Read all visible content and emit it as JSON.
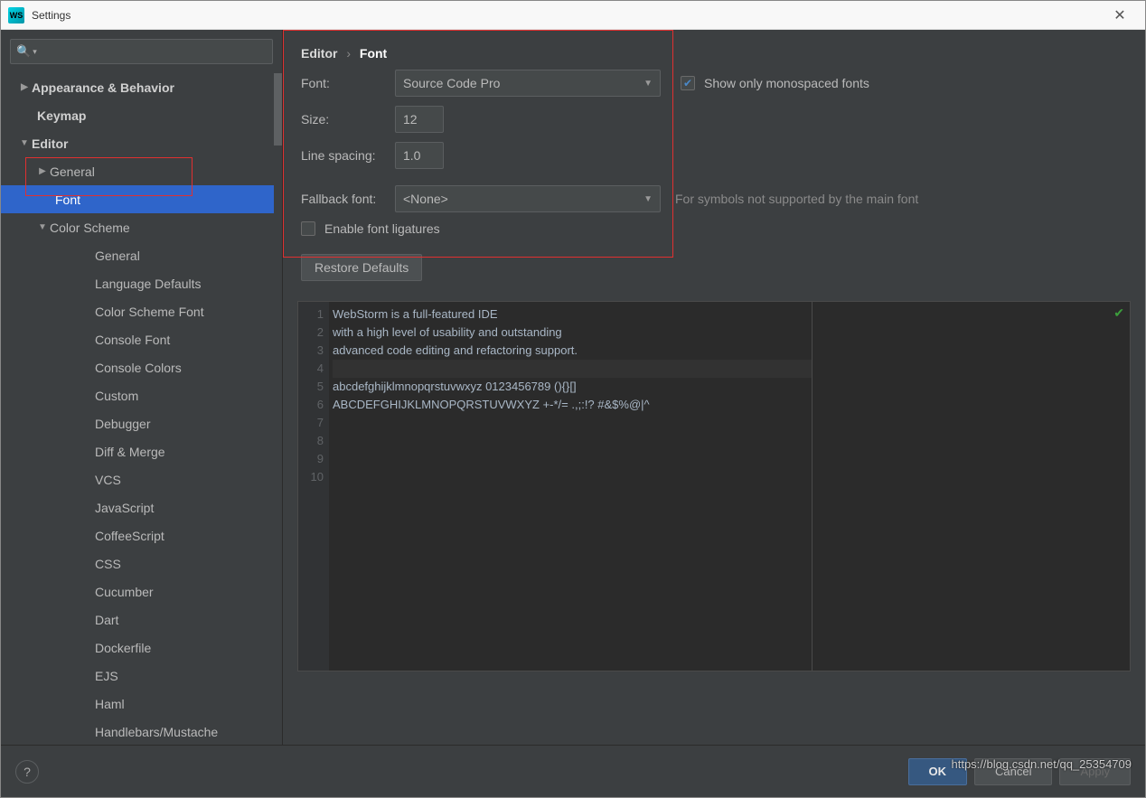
{
  "window": {
    "title": "Settings"
  },
  "breadcrumb": {
    "root": "Editor",
    "current": "Font"
  },
  "sidebar": {
    "items": [
      {
        "label": "Appearance & Behavior",
        "level": 0,
        "arrow": "▶",
        "bold": true
      },
      {
        "label": "Keymap",
        "level": 0,
        "arrow": "",
        "bold": true
      },
      {
        "label": "Editor",
        "level": 0,
        "arrow": "▼",
        "bold": true
      },
      {
        "label": "General",
        "level": 1,
        "arrow": "▶",
        "bold": false
      },
      {
        "label": "Font",
        "level": 1,
        "arrow": "",
        "bold": false,
        "selected": true
      },
      {
        "label": "Color Scheme",
        "level": 1,
        "arrow": "▼",
        "bold": false
      },
      {
        "label": "General",
        "level": 2,
        "arrow": "",
        "bold": false
      },
      {
        "label": "Language Defaults",
        "level": 2,
        "arrow": "",
        "bold": false
      },
      {
        "label": "Color Scheme Font",
        "level": 2,
        "arrow": "",
        "bold": false
      },
      {
        "label": "Console Font",
        "level": 2,
        "arrow": "",
        "bold": false
      },
      {
        "label": "Console Colors",
        "level": 2,
        "arrow": "",
        "bold": false
      },
      {
        "label": "Custom",
        "level": 2,
        "arrow": "",
        "bold": false
      },
      {
        "label": "Debugger",
        "level": 2,
        "arrow": "",
        "bold": false
      },
      {
        "label": "Diff & Merge",
        "level": 2,
        "arrow": "",
        "bold": false
      },
      {
        "label": "VCS",
        "level": 2,
        "arrow": "",
        "bold": false
      },
      {
        "label": "JavaScript",
        "level": 2,
        "arrow": "",
        "bold": false
      },
      {
        "label": "CoffeeScript",
        "level": 2,
        "arrow": "",
        "bold": false
      },
      {
        "label": "CSS",
        "level": 2,
        "arrow": "",
        "bold": false
      },
      {
        "label": "Cucumber",
        "level": 2,
        "arrow": "",
        "bold": false
      },
      {
        "label": "Dart",
        "level": 2,
        "arrow": "",
        "bold": false
      },
      {
        "label": "Dockerfile",
        "level": 2,
        "arrow": "",
        "bold": false
      },
      {
        "label": "EJS",
        "level": 2,
        "arrow": "",
        "bold": false
      },
      {
        "label": "Haml",
        "level": 2,
        "arrow": "",
        "bold": false
      },
      {
        "label": "Handlebars/Mustache",
        "level": 2,
        "arrow": "",
        "bold": false
      }
    ]
  },
  "form": {
    "font_label": "Font:",
    "font_value": "Source Code Pro",
    "monospace_label": "Show only monospaced fonts",
    "size_label": "Size:",
    "size_value": "12",
    "linespacing_label": "Line spacing:",
    "linespacing_value": "1.0",
    "fallback_label": "Fallback font:",
    "fallback_value": "<None>",
    "fallback_hint": "For symbols not supported by the main font",
    "ligatures_label": "Enable font ligatures",
    "restore_label": "Restore Defaults"
  },
  "preview": {
    "lines": [
      "WebStorm is a full-featured IDE",
      "with a high level of usability and outstanding",
      "advanced code editing and refactoring support.",
      "",
      "abcdefghijklmnopqrstuvwxyz 0123456789 (){}[]",
      "ABCDEFGHIJKLMNOPQRSTUVWXYZ +-*/= .,;:!? #&$%@|^",
      "",
      "",
      "",
      ""
    ]
  },
  "footer": {
    "ok": "OK",
    "cancel": "Cancel",
    "apply": "Apply"
  },
  "watermark": "https://blog.csdn.net/qq_25354709"
}
